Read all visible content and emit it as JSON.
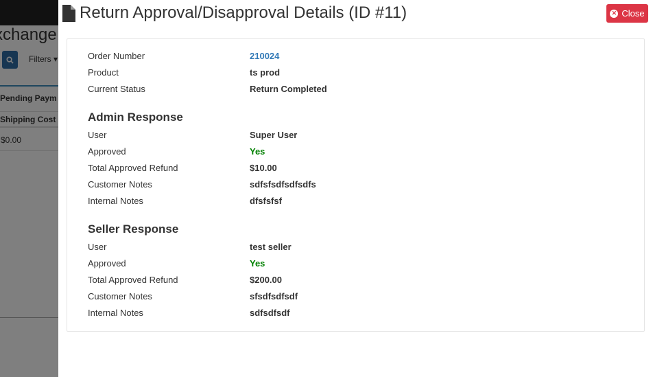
{
  "background": {
    "title": "xchange I",
    "filters_label": "Filters ▾",
    "tab_label": "Pending Paym",
    "table_header": "Shipping Cost",
    "table_cell": "$0.00"
  },
  "modal": {
    "title": "Return Approval/Disapproval Details (ID #11)",
    "close_label": "Close",
    "colors": {
      "accent_link": "#337ab7",
      "approved_green": "#008000",
      "close_red": "#dc3545"
    },
    "order": {
      "order_number_label": "Order Number",
      "order_number": "210024",
      "product_label": "Product",
      "product": "ts prod",
      "status_label": "Current Status",
      "status": "Return Completed"
    },
    "admin": {
      "heading": "Admin Response",
      "user_label": "User",
      "user": "Super User",
      "approved_label": "Approved",
      "approved": "Yes",
      "refund_label": "Total Approved Refund",
      "refund": "$10.00",
      "customer_notes_label": "Customer Notes",
      "customer_notes": "sdfsfsdfsdfsdfs",
      "internal_notes_label": "Internal Notes",
      "internal_notes": "dfsfsfsf"
    },
    "seller": {
      "heading": "Seller Response",
      "user_label": "User",
      "user": "test seller",
      "approved_label": "Approved",
      "approved": "Yes",
      "refund_label": "Total Approved Refund",
      "refund": "$200.00",
      "customer_notes_label": "Customer Notes",
      "customer_notes": "sfsdfsdfsdf",
      "internal_notes_label": "Internal Notes",
      "internal_notes": "sdfsdfsdf"
    }
  }
}
